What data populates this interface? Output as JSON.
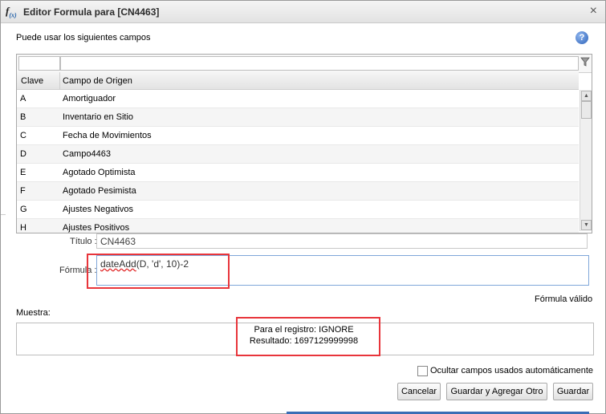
{
  "window": {
    "title": "Editor Formula para [CN4463]",
    "close_symbol": "×",
    "icon": "formula-icon"
  },
  "intro_text": "Puede usar los siguientes campos",
  "help_icon": "help-icon",
  "grid": {
    "filter_icon": "filter-icon",
    "headers": {
      "clave": "Clave",
      "campo": "Campo de Origen"
    },
    "rows": [
      {
        "k": "A",
        "v": "Amortiguador"
      },
      {
        "k": "B",
        "v": "Inventario en Sitio"
      },
      {
        "k": "C",
        "v": "Fecha de Movimientos"
      },
      {
        "k": "D",
        "v": "Campo4463"
      },
      {
        "k": "E",
        "v": "Agotado Optimista"
      },
      {
        "k": "F",
        "v": "Agotado Pesimista"
      },
      {
        "k": "G",
        "v": "Ajustes Negativos"
      },
      {
        "k": "H",
        "v": "Ajustes Positivos"
      }
    ]
  },
  "form": {
    "titulo_label": "Título :",
    "titulo_value": "CN4463",
    "formula_label": "Fórmula :",
    "formula_fn": "dateAdd",
    "formula_rest": "(D, 'd', 10)-2",
    "valid_text": "Fórmula válido"
  },
  "sample": {
    "label": "Muestra:",
    "line1": "Para el registro: IGNORE",
    "line2": "Resultado: 1697129999998"
  },
  "options": {
    "hide_used_label": "Ocultar campos usados automáticamente",
    "hide_used_checked": false
  },
  "buttons": {
    "cancel": "Cancelar",
    "save_add": "Guardar y Agregar Otro",
    "save": "Guardar"
  },
  "colors": {
    "highlight_red": "#e8353b",
    "accent_blue": "#3a6db5"
  }
}
